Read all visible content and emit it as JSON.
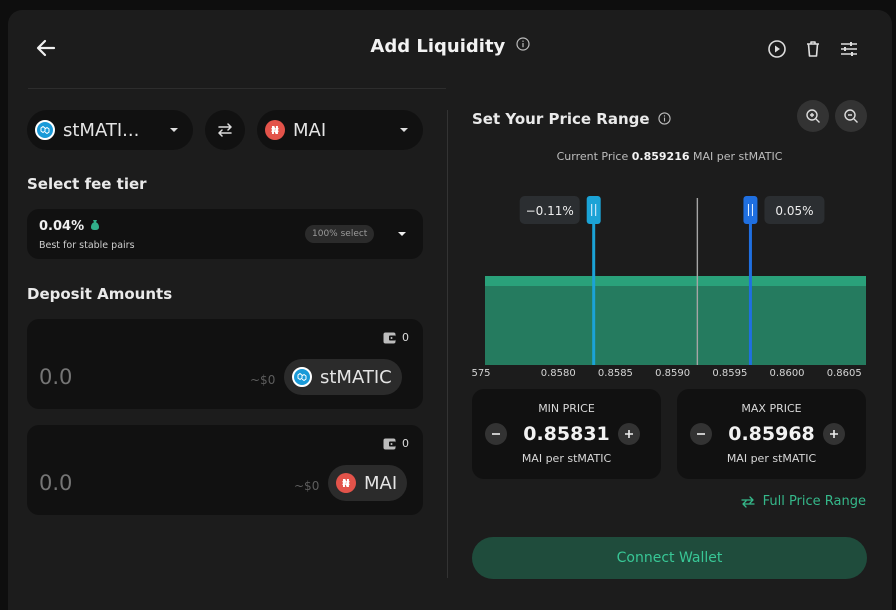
{
  "header": {
    "title": "Add Liquidity",
    "icons": [
      "back-arrow-icon",
      "info-icon",
      "play-circle-icon",
      "trash-icon",
      "sliders-icon"
    ]
  },
  "pair": {
    "token_a": {
      "name": "stMATI...",
      "icon": "stmatic-logo"
    },
    "token_b": {
      "name": "MAI",
      "icon": "mai-logo"
    }
  },
  "fee": {
    "label": "Select fee tier",
    "percent": "0.04%",
    "description": "Best for stable pairs",
    "badge": "100% select"
  },
  "deposit": {
    "label": "Deposit Amounts",
    "items": [
      {
        "amount_placeholder": "0.0",
        "usd": "~$0",
        "token": "stMATIC",
        "balance": "0"
      },
      {
        "amount_placeholder": "0.0",
        "usd": "~$0",
        "token": "MAI",
        "balance": "0"
      }
    ]
  },
  "range": {
    "title": "Set Your Price Range",
    "current_price_label": "Current Price",
    "current_price_value": "0.859216",
    "current_price_unit": "MAI per stMATIC",
    "min_pct": "−0.11%",
    "max_pct": "0.05%"
  },
  "chart_data": {
    "type": "area",
    "x_ticks": [
      "575",
      "0.8580",
      "0.8585",
      "0.8590",
      "0.8595",
      "0.8600",
      "0.8605"
    ],
    "xlim": [
      0.85736,
      0.86069
    ],
    "current_price": 0.859216,
    "min_price": 0.85831,
    "max_price": 0.85968,
    "liquidity_level": 1.0,
    "colors": {
      "liquidity": "#2aa17a",
      "min_handle": "#1ba3d6",
      "max_handle": "#1f6fe0",
      "current_line": "#a5a5a5"
    }
  },
  "min_price": {
    "label": "MIN PRICE",
    "value": "0.85831",
    "unit": "MAI per stMATIC"
  },
  "max_price": {
    "label": "MAX PRICE",
    "value": "0.85968",
    "unit": "MAI per stMATIC"
  },
  "full_range_label": "Full Price Range",
  "connect_label": "Connect Wallet"
}
